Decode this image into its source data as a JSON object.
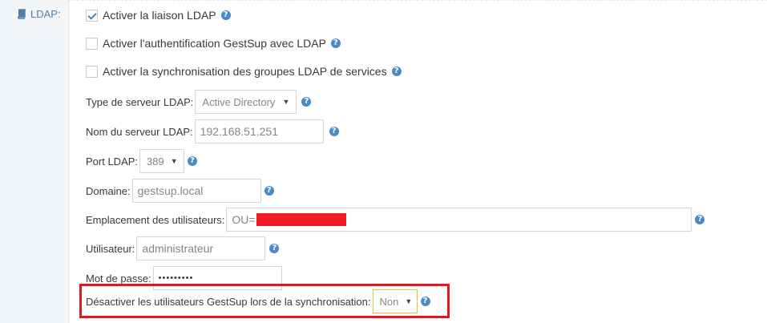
{
  "section": {
    "label": "LDAP:",
    "icon": "book-icon"
  },
  "checkboxes": [
    {
      "label": "Activer la liaison LDAP",
      "checked": true
    },
    {
      "label": "Activer l'authentification GestSup avec LDAP",
      "checked": false
    },
    {
      "label": "Activer la synchronisation des groupes LDAP de services",
      "checked": false
    }
  ],
  "fields": {
    "server_type": {
      "label": "Type de serveur LDAP:",
      "value": "Active Directory"
    },
    "server_name": {
      "label": "Nom du serveur LDAP:",
      "value": "192.168.51.251"
    },
    "port": {
      "label": "Port LDAP:",
      "value": "389"
    },
    "domain": {
      "label": "Domaine:",
      "value": "gestsup.local"
    },
    "users_location": {
      "label": "Emplacement des utilisateurs:",
      "value": "OU="
    },
    "user": {
      "label": "Utilisateur:",
      "value": "administrateur"
    },
    "password": {
      "label": "Mot de passe:",
      "value": "•••••••••"
    },
    "disable_users": {
      "label": "Désactiver les utilisateurs GestSup lors de la synchronisation:",
      "value": "Non"
    }
  },
  "help_glyph": "?",
  "colors": {
    "accent": "#4a8ac7",
    "highlight": "#e3171f",
    "redaction": "#ec1c24"
  }
}
